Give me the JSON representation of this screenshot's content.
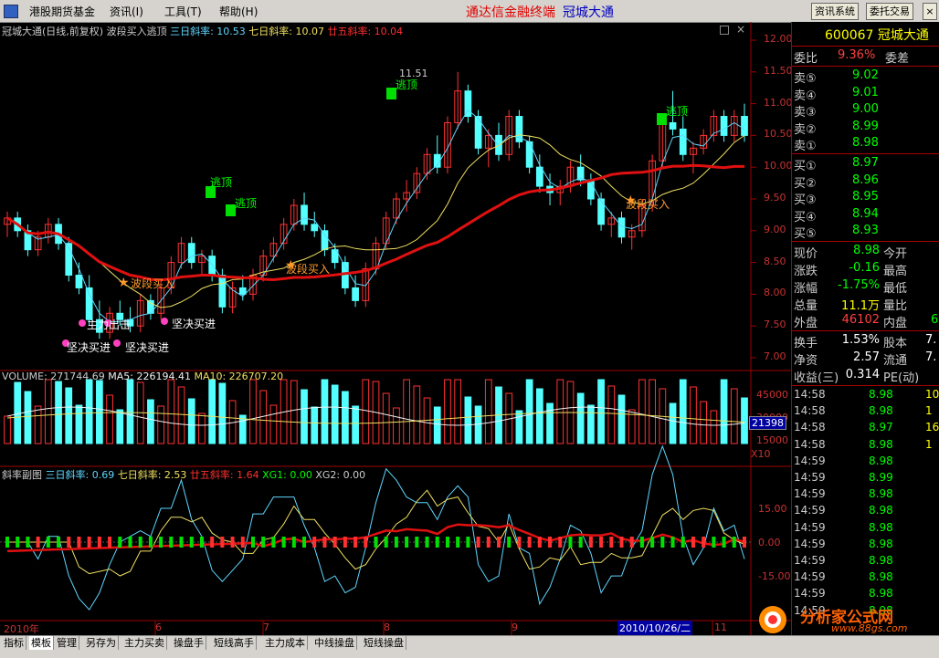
{
  "menu": {
    "items": [
      "港股期货基金",
      "资讯(I)",
      "工具(T)",
      "帮助(H)"
    ],
    "brand": "通达信金融终端",
    "stock_name": "冠城大通",
    "btn_info": "资讯系统",
    "btn_trade": "委托交易",
    "btn_close": "×"
  },
  "main_chart": {
    "title": "冠城大通(日线,前复权) 波段买入逃顶",
    "s3_label": "三日斜率: 10.53",
    "s7_label": "七日斜率: 10.07",
    "s25_label": "廿五斜率: 10.04",
    "y_ticks": [
      "12.00",
      "11.50",
      "11.00",
      "10.50",
      "10.00",
      "9.50",
      "9.00",
      "8.50",
      "8.00",
      "7.50",
      "7.00"
    ],
    "high_marker": "11.51",
    "annotations": {
      "escape": "逃顶",
      "wave_buy": "波段买入",
      "resolute_buy": "坚决买进",
      "main_attack": "主力出击"
    }
  },
  "volume_chart": {
    "label": "VOLUME: 271744.69",
    "ma5": "MA5: 226194.41",
    "ma10": "MA10: 226707.20",
    "y_ticks": [
      "45000",
      "30000",
      "15000"
    ],
    "unit": "X10",
    "current": "21398"
  },
  "slope_chart": {
    "label": "斜率副图",
    "s3": "三日斜率: 0.69",
    "s7": "七日斜率: 2.53",
    "s25": "廿五斜率: 1.64",
    "xg1": "XG1: 0.00",
    "xg2": "XG2: 0.00",
    "y_ticks": [
      "15.00",
      "0.00",
      "-15.00"
    ]
  },
  "x_axis": {
    "labels": [
      "2010年",
      "6",
      "7",
      "8",
      "9",
      "11"
    ],
    "cursor_date": "2010/10/26/二"
  },
  "quote": {
    "code": "600067",
    "name": "冠城大通",
    "weibi_label": "委比",
    "weibi_value": "9.36%",
    "weicha_label": "委差",
    "sells": [
      {
        "label": "卖⑤",
        "price": "9.02"
      },
      {
        "label": "卖④",
        "price": "9.01"
      },
      {
        "label": "卖③",
        "price": "9.00"
      },
      {
        "label": "卖②",
        "price": "8.99"
      },
      {
        "label": "卖①",
        "price": "8.98"
      }
    ],
    "buys": [
      {
        "label": "买①",
        "price": "8.97"
      },
      {
        "label": "买②",
        "price": "8.96"
      },
      {
        "label": "买③",
        "price": "8.95"
      },
      {
        "label": "买④",
        "price": "8.94"
      },
      {
        "label": "买⑤",
        "price": "8.93"
      }
    ],
    "stats": [
      {
        "l1": "现价",
        "v1": "8.98",
        "l2": "今开",
        "c": "#00ff00"
      },
      {
        "l1": "涨跌",
        "v1": "-0.16",
        "l2": "最高",
        "c": "#00ff00"
      },
      {
        "l1": "涨幅",
        "v1": "-1.75%",
        "l2": "最低",
        "c": "#00ff00"
      },
      {
        "l1": "总量",
        "v1": "11.1万",
        "l2": "量比",
        "c": "#ffff00"
      },
      {
        "l1": "外盘",
        "v1": "46102",
        "l2": "内盘",
        "c": "#ff4040"
      }
    ],
    "waipan_extra": "6",
    "stats2": [
      {
        "l1": "换手",
        "v1": "1.53%",
        "l2": "股本",
        "v2": "7."
      },
      {
        "l1": "净资",
        "v1": "2.57",
        "l2": "流通",
        "v2": "7."
      },
      {
        "l1": "收益(三)",
        "v1": "0.314",
        "l2": "PE(动)",
        "v2": ""
      }
    ],
    "ticks": [
      {
        "t": "14:58",
        "p": "8.98",
        "v": "10"
      },
      {
        "t": "14:58",
        "p": "8.98",
        "v": "1"
      },
      {
        "t": "14:58",
        "p": "8.97",
        "v": "16"
      },
      {
        "t": "14:58",
        "p": "8.98",
        "v": "1"
      },
      {
        "t": "14:59",
        "p": "8.98",
        "v": ""
      },
      {
        "t": "14:59",
        "p": "8.99",
        "v": ""
      },
      {
        "t": "14:59",
        "p": "8.98",
        "v": ""
      },
      {
        "t": "14:59",
        "p": "8.98",
        "v": ""
      },
      {
        "t": "14:59",
        "p": "8.98",
        "v": ""
      },
      {
        "t": "14:59",
        "p": "8.98",
        "v": ""
      },
      {
        "t": "14:59",
        "p": "8.98",
        "v": ""
      },
      {
        "t": "14:59",
        "p": "8.98",
        "v": ""
      },
      {
        "t": "14:59",
        "p": "8.98",
        "v": ""
      },
      {
        "t": "14:59",
        "p": "8.98",
        "v": ""
      }
    ]
  },
  "tabs": [
    "指标",
    "模板",
    "管理",
    "另存为",
    "主力买卖",
    "操盘手",
    "短线高手",
    "主力成本",
    "中线操盘",
    "短线操盘"
  ],
  "watermark": {
    "text": "分析家公式网",
    "url": "www.88gs.com"
  },
  "chart_data": {
    "type": "candlestick",
    "title": "冠城大通(日线,前复权) 波段买入逃顶",
    "ylim": [
      6.8,
      12.2
    ],
    "candles": [
      [
        9.1,
        9.3,
        8.9,
        9.2
      ],
      [
        9.2,
        9.3,
        8.9,
        9.0
      ],
      [
        9.0,
        9.1,
        8.6,
        8.7
      ],
      [
        8.7,
        9.0,
        8.6,
        8.9
      ],
      [
        8.9,
        9.2,
        8.8,
        9.1
      ],
      [
        9.1,
        9.2,
        8.7,
        8.8
      ],
      [
        8.8,
        8.9,
        8.2,
        8.3
      ],
      [
        8.3,
        8.5,
        8.0,
        8.1
      ],
      [
        8.1,
        8.3,
        7.5,
        7.6
      ],
      [
        7.6,
        7.9,
        7.3,
        7.4
      ],
      [
        7.4,
        7.8,
        7.3,
        7.7
      ],
      [
        7.7,
        7.9,
        7.5,
        7.6
      ],
      [
        7.6,
        7.8,
        7.4,
        7.5
      ],
      [
        7.5,
        8.0,
        7.4,
        7.9
      ],
      [
        7.9,
        8.0,
        7.6,
        7.7
      ],
      [
        7.7,
        8.2,
        7.6,
        8.1
      ],
      [
        8.1,
        8.6,
        8.0,
        8.5
      ],
      [
        8.5,
        8.9,
        8.4,
        8.8
      ],
      [
        8.8,
        8.9,
        8.4,
        8.5
      ],
      [
        8.5,
        8.7,
        8.3,
        8.6
      ],
      [
        8.6,
        8.7,
        8.2,
        8.3
      ],
      [
        8.3,
        8.4,
        7.7,
        7.8
      ],
      [
        7.8,
        8.2,
        7.7,
        8.1
      ],
      [
        8.1,
        8.3,
        7.9,
        8.0
      ],
      [
        8.0,
        8.4,
        7.9,
        8.3
      ],
      [
        8.3,
        8.7,
        8.2,
        8.6
      ],
      [
        8.6,
        8.9,
        8.5,
        8.8
      ],
      [
        8.8,
        9.2,
        8.7,
        9.1
      ],
      [
        9.1,
        9.5,
        9.0,
        9.4
      ],
      [
        9.4,
        9.6,
        9.0,
        9.1
      ],
      [
        9.1,
        9.3,
        8.9,
        9.0
      ],
      [
        9.0,
        9.1,
        8.6,
        8.7
      ],
      [
        8.7,
        8.8,
        8.4,
        8.5
      ],
      [
        8.5,
        8.6,
        8.0,
        8.1
      ],
      [
        8.1,
        8.3,
        7.8,
        7.9
      ],
      [
        7.9,
        8.5,
        7.8,
        8.4
      ],
      [
        8.4,
        8.9,
        8.3,
        8.8
      ],
      [
        8.8,
        9.3,
        8.7,
        9.2
      ],
      [
        9.2,
        9.6,
        9.1,
        9.5
      ],
      [
        9.5,
        9.8,
        9.3,
        9.6
      ],
      [
        9.6,
        10.0,
        9.5,
        9.9
      ],
      [
        9.9,
        10.3,
        9.8,
        10.2
      ],
      [
        10.2,
        10.5,
        9.9,
        10.0
      ],
      [
        10.0,
        10.8,
        9.9,
        10.7
      ],
      [
        10.7,
        11.5,
        10.6,
        11.2
      ],
      [
        11.2,
        11.3,
        10.7,
        10.8
      ],
      [
        10.8,
        10.9,
        10.2,
        10.3
      ],
      [
        10.3,
        10.6,
        10.0,
        10.5
      ],
      [
        10.5,
        10.7,
        10.1,
        10.2
      ],
      [
        10.2,
        10.9,
        10.1,
        10.8
      ],
      [
        10.8,
        10.9,
        10.3,
        10.4
      ],
      [
        10.4,
        10.5,
        9.9,
        10.0
      ],
      [
        10.0,
        10.2,
        9.6,
        9.7
      ],
      [
        9.7,
        9.9,
        9.4,
        9.6
      ],
      [
        9.6,
        9.8,
        9.4,
        9.7
      ],
      [
        9.7,
        10.1,
        9.6,
        10.0
      ],
      [
        10.0,
        10.2,
        9.7,
        9.8
      ],
      [
        9.8,
        9.9,
        9.4,
        9.5
      ],
      [
        9.5,
        9.6,
        9.0,
        9.1
      ],
      [
        9.1,
        9.3,
        8.9,
        9.2
      ],
      [
        9.2,
        9.3,
        8.8,
        8.9
      ],
      [
        8.9,
        9.1,
        8.7,
        9.0
      ],
      [
        9.0,
        9.5,
        8.9,
        9.4
      ],
      [
        9.4,
        10.2,
        9.3,
        10.1
      ],
      [
        10.1,
        10.8,
        10.0,
        10.7
      ],
      [
        10.7,
        11.2,
        10.5,
        10.6
      ],
      [
        10.6,
        10.8,
        10.1,
        10.2
      ],
      [
        10.2,
        10.4,
        9.9,
        10.3
      ],
      [
        10.3,
        10.6,
        10.2,
        10.5
      ],
      [
        10.5,
        10.9,
        10.4,
        10.8
      ],
      [
        10.8,
        10.9,
        10.4,
        10.5
      ],
      [
        10.5,
        10.9,
        10.4,
        10.8
      ],
      [
        10.8,
        11.0,
        10.4,
        10.5
      ]
    ],
    "ma": [
      {
        "name": "三日斜率",
        "color": "#5fd7ff"
      },
      {
        "name": "七日斜率",
        "color": "#f0e060"
      },
      {
        "name": "廿五斜率",
        "color": "#e01010"
      }
    ]
  }
}
